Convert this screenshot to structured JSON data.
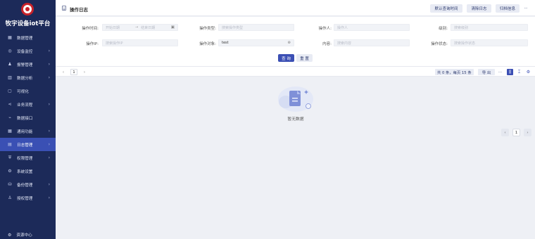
{
  "sidebar": {
    "brand": "牧宇设备iot平台",
    "items": [
      {
        "label": "数据管理",
        "icon": "data-management-icon",
        "glyph": "▦",
        "has_arrow": false,
        "active": false
      },
      {
        "label": "设备监控",
        "icon": "device-monitor-icon",
        "glyph": "◎",
        "has_arrow": true,
        "active": false
      },
      {
        "label": "报警管理",
        "icon": "alarm-icon",
        "glyph": "♟",
        "has_arrow": true,
        "active": false
      },
      {
        "label": "数据分析",
        "icon": "analytics-icon",
        "glyph": "▥",
        "has_arrow": true,
        "active": false
      },
      {
        "label": "可视化",
        "icon": "visualization-icon",
        "glyph": "▢",
        "has_arrow": false,
        "active": false
      },
      {
        "label": "业务流程",
        "icon": "workflow-icon",
        "glyph": "⋖",
        "has_arrow": true,
        "active": false
      },
      {
        "label": "数据接口",
        "icon": "api-icon",
        "glyph": "⌁",
        "has_arrow": false,
        "active": false
      },
      {
        "label": "通用功能",
        "icon": "grid-icon",
        "glyph": "▦",
        "has_arrow": true,
        "active": false
      },
      {
        "label": "日志管理",
        "icon": "log-icon",
        "glyph": "▤",
        "has_arrow": true,
        "active": true
      },
      {
        "label": "权限管理",
        "icon": "permission-icon",
        "glyph": "⛨",
        "has_arrow": true,
        "active": false
      },
      {
        "label": "系统设置",
        "icon": "settings-icon",
        "glyph": "⚙",
        "has_arrow": false,
        "active": false
      },
      {
        "label": "备份管理",
        "icon": "backup-icon",
        "glyph": "⛁",
        "has_arrow": true,
        "active": false
      },
      {
        "label": "授权管理",
        "icon": "license-icon",
        "glyph": "♙",
        "has_arrow": true,
        "active": false
      }
    ],
    "footer": {
      "label": "资源中心",
      "icon": "resource-center-icon",
      "glyph": "⚙"
    }
  },
  "header": {
    "title": "操作日志",
    "buttons": {
      "default_time": "默认查询时间",
      "clear_log": "清除日志",
      "archive_info": "归档信息",
      "more": "···"
    }
  },
  "filters": {
    "op_time": {
      "label": "操作时间:",
      "start_placeholder": "开始日期",
      "end_placeholder": "结束日期",
      "separator": "→"
    },
    "op_type": {
      "label": "操作类型:",
      "placeholder": "搜索操作类型"
    },
    "operator": {
      "label": "操作人:",
      "placeholder": "操作人"
    },
    "level": {
      "label": "级别:",
      "placeholder": "搜索级别"
    },
    "op_ip": {
      "label": "操作IP:",
      "placeholder": "搜索操作IP"
    },
    "op_object": {
      "label": "操作对象:",
      "value": "test"
    },
    "content": {
      "label": "内容:",
      "placeholder": "搜索内容"
    },
    "op_status": {
      "label": "操作状态:",
      "placeholder": "搜索操作状态"
    },
    "query": "查 询",
    "reset": "重 置"
  },
  "toolbar": {
    "page": "1",
    "prev": "‹",
    "next": "›",
    "summary": "共 0 条，每页 15 条",
    "export": "导 出",
    "more": "···"
  },
  "empty": {
    "text": "暂无数据"
  },
  "bottom_pager": {
    "prev": "‹",
    "page": "1",
    "next": "›"
  }
}
